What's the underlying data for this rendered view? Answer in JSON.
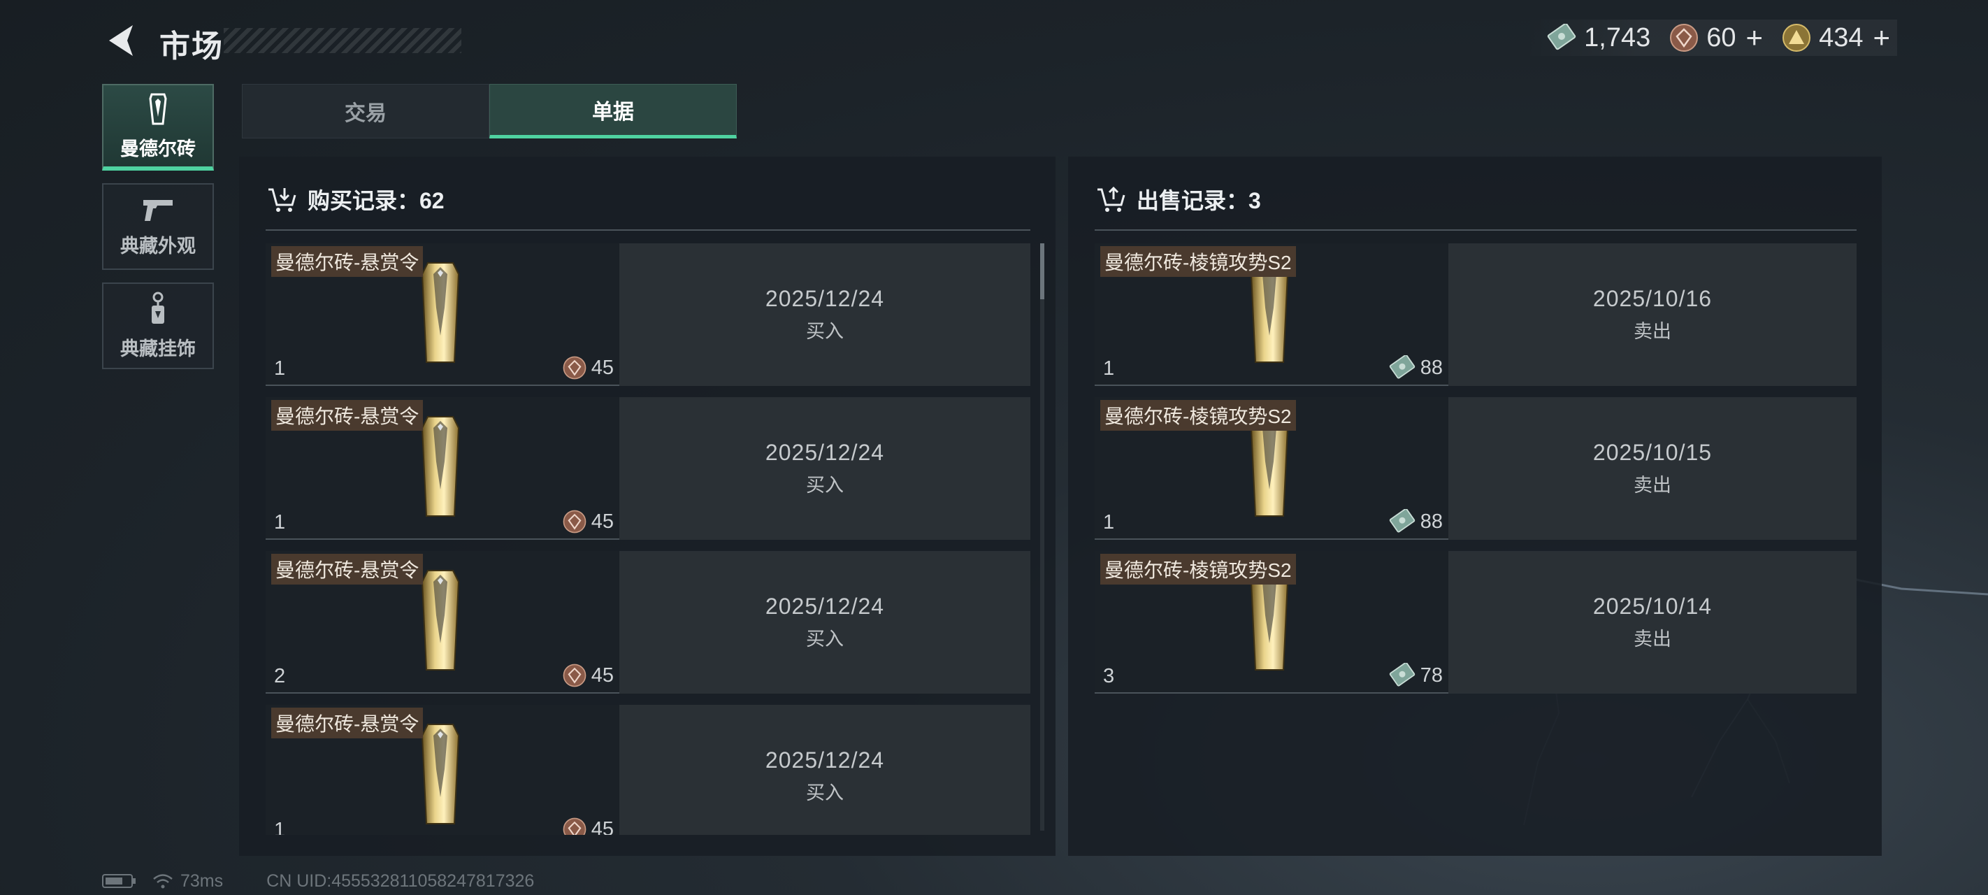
{
  "header": {
    "title": "市场"
  },
  "currencies": [
    {
      "icon": "banknote-icon",
      "value": "1,743",
      "plus": ""
    },
    {
      "icon": "bronze-coin-icon",
      "value": "60",
      "plus": "+"
    },
    {
      "icon": "gold-coin-icon",
      "value": "434",
      "plus": "+"
    }
  ],
  "nav": [
    {
      "label": "曼德尔砖",
      "icon": "mandel-brick-icon",
      "active": true
    },
    {
      "label": "典藏外观",
      "icon": "pistol-icon",
      "active": false
    },
    {
      "label": "典藏挂饰",
      "icon": "charm-icon",
      "active": false
    }
  ],
  "tabs": [
    {
      "label": "交易",
      "active": false
    },
    {
      "label": "单据",
      "active": true
    }
  ],
  "purchase": {
    "title": "购买记录：62",
    "rows": [
      {
        "name": "曼德尔砖-悬赏令",
        "qty": "1",
        "price": "45",
        "date": "2025/12/24",
        "action": "买入"
      },
      {
        "name": "曼德尔砖-悬赏令",
        "qty": "1",
        "price": "45",
        "date": "2025/12/24",
        "action": "买入"
      },
      {
        "name": "曼德尔砖-悬赏令",
        "qty": "2",
        "price": "45",
        "date": "2025/12/24",
        "action": "买入"
      },
      {
        "name": "曼德尔砖-悬赏令",
        "qty": "1",
        "price": "45",
        "date": "2025/12/24",
        "action": "买入"
      }
    ]
  },
  "sales": {
    "title": "出售记录：3",
    "rows": [
      {
        "name": "曼德尔砖-棱镜攻势S2",
        "qty": "1",
        "price": "88",
        "date": "2025/10/16",
        "action": "卖出"
      },
      {
        "name": "曼德尔砖-棱镜攻势S2",
        "qty": "1",
        "price": "88",
        "date": "2025/10/15",
        "action": "卖出"
      },
      {
        "name": "曼德尔砖-棱镜攻势S2",
        "qty": "3",
        "price": "78",
        "date": "2025/10/14",
        "action": "卖出"
      }
    ]
  },
  "status": {
    "ping": "73ms",
    "uid": "CN UID:455532811058247817326"
  },
  "colors": {
    "accent": "#4fd3a1",
    "name_tag": "#4a3a2e",
    "panel": "#181e24"
  }
}
